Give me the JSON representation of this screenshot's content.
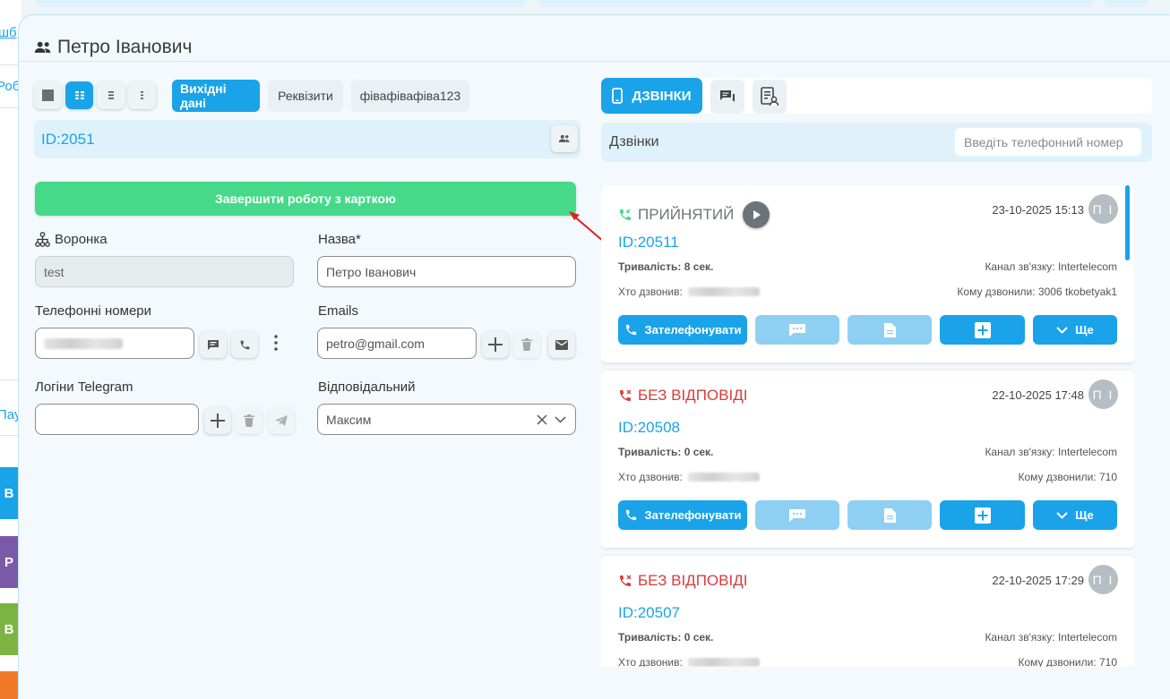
{
  "background": {
    "edge_texts": [
      "шб",
      "Роб",
      "Пау"
    ],
    "blocks": [
      {
        "letter": "В",
        "color": "#1aa3e8"
      },
      {
        "letter": "Р",
        "color": "#7a5aa6"
      },
      {
        "letter": "В",
        "color": "#7cb342"
      },
      {
        "letter": "",
        "color": "#f07a2a"
      }
    ]
  },
  "modal": {
    "title": "Петро Іванович",
    "title_icon": "people-icon"
  },
  "left": {
    "view_buttons": [
      {
        "icon": "square-icon",
        "active": false
      },
      {
        "icon": "grid-icon",
        "active": true
      },
      {
        "icon": "list-icon",
        "active": false
      },
      {
        "icon": "narrow-list-icon",
        "active": false
      }
    ],
    "tabs": [
      {
        "label": "Вихідні дані",
        "active": true
      },
      {
        "label": "Реквізити",
        "active": false
      },
      {
        "label": "фівафівафіва123",
        "active": false
      }
    ],
    "id_text": "ID:2051",
    "finish_label": "Завершити роботу з карткою",
    "funnel": {
      "label": "Воронка",
      "value": "test"
    },
    "name": {
      "label": "Назва*",
      "value": "Петро Іванович"
    },
    "phones": {
      "label": "Телефонні номери"
    },
    "emails": {
      "label": "Emails",
      "value": "petro@gmail.com"
    },
    "telegram": {
      "label": "Логіни Telegram",
      "value": ""
    },
    "responsible": {
      "label": "Відповідальний",
      "value": "Максим"
    }
  },
  "right": {
    "calls_tab": "ДЗВІНКИ",
    "header_title": "Дзвінки",
    "search_placeholder": "Введіть телефонний номер",
    "calls": [
      {
        "status": "ПРИЙНЯТИЙ",
        "kind": "accepted",
        "datetime": "23-10-2025 15:13",
        "avatar": "П І",
        "id": "ID:20511",
        "duration": "Тривалість: 8 сек.",
        "channel": "Канал зв'язку: Intertelecom",
        "who": "Хто дзвонив:",
        "to": "Кому дзвонили: 3006 tkobetyak1"
      },
      {
        "status": "БЕЗ ВІДПОВІДІ",
        "kind": "missed",
        "datetime": "22-10-2025 17:48",
        "avatar": "П І",
        "id": "ID:20508",
        "duration": "Тривалість: 0 сек.",
        "channel": "Канал зв'язку: Intertelecom",
        "who": "Хто дзвонив:",
        "to": "Кому дзвонили: 710"
      },
      {
        "status": "БЕЗ ВІДПОВІДІ",
        "kind": "missed",
        "datetime": "22-10-2025 17:29",
        "avatar": "П І",
        "id": "ID:20507",
        "duration": "Тривалість: 0 сек.",
        "channel": "Канал зв'язку: Intertelecom",
        "who": "Хто дзвонив:",
        "to": "Кому дзвонили: 710"
      }
    ],
    "call_button": "Зателефонувати",
    "more_button": "Ще"
  },
  "colors": {
    "accent": "#1aa3e8",
    "success": "#46d98a",
    "missed": "#d83c3c"
  }
}
